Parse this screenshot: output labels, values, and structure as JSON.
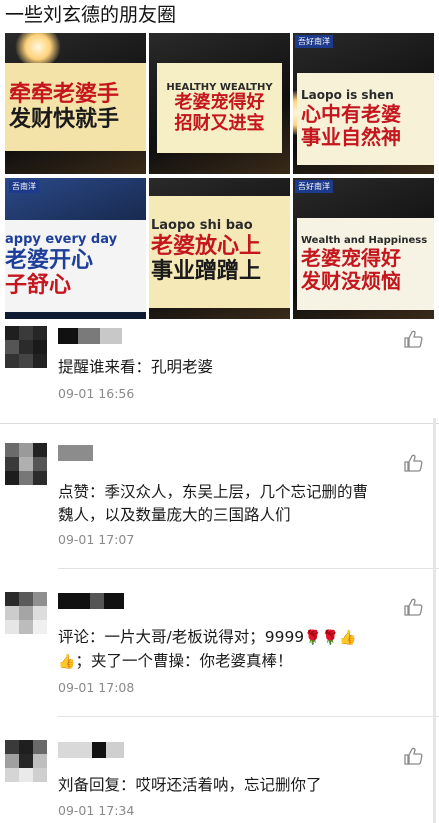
{
  "header": {
    "title": "一些刘玄德的朋友圈"
  },
  "photos": [
    {
      "lines": [
        "牵牵老婆手",
        "发财快就手"
      ],
      "tag": ""
    },
    {
      "english": "HEALTHY WEALTHY",
      "lines": [
        "老婆宠得好",
        "招财又进宝"
      ],
      "tag": ""
    },
    {
      "english": "Laopo is shen",
      "lines": [
        "心中有老婆",
        "事业自然神"
      ],
      "tag": "吾好南洋"
    },
    {
      "english": "appy every day",
      "lines": [
        "老婆开心",
        "子舒心"
      ],
      "tag": "吾南洋"
    },
    {
      "english": "Laopo shi bao",
      "lines": [
        "老婆放心上",
        "事业蹭蹭上"
      ],
      "tag": ""
    },
    {
      "english": "Wealth and Happiness",
      "lines": [
        "老婆宠得好",
        "发财没烦恼"
      ],
      "tag": "吾好南洋"
    }
  ],
  "comments": [
    {
      "text": "提醒谁来看：孔明老婆",
      "time": "09-01 16:56"
    },
    {
      "text_line1": "点赞：季汉众人，东吴上层，几个忘记删的曹",
      "text_line2": "魏人，以及数量庞大的三国路人们",
      "time": "09-01 17:07"
    },
    {
      "text_line1": "评论：一片大哥/老板说得对；9999",
      "text_line2": "；夹了一个曹操：你老婆真棒！",
      "time": "09-01 17:08"
    },
    {
      "text": "刘备回复：哎呀还活着呐，忘记删你了",
      "time": "09-01 17:34"
    }
  ],
  "icons": {
    "like": "thumbs-up-outline-icon",
    "rose": "rose-emoji",
    "thumbs_emoji": "thumbs-up-emoji"
  },
  "colors": {
    "sign_red": "#c4161c",
    "time_gray": "#8a8a8a"
  }
}
